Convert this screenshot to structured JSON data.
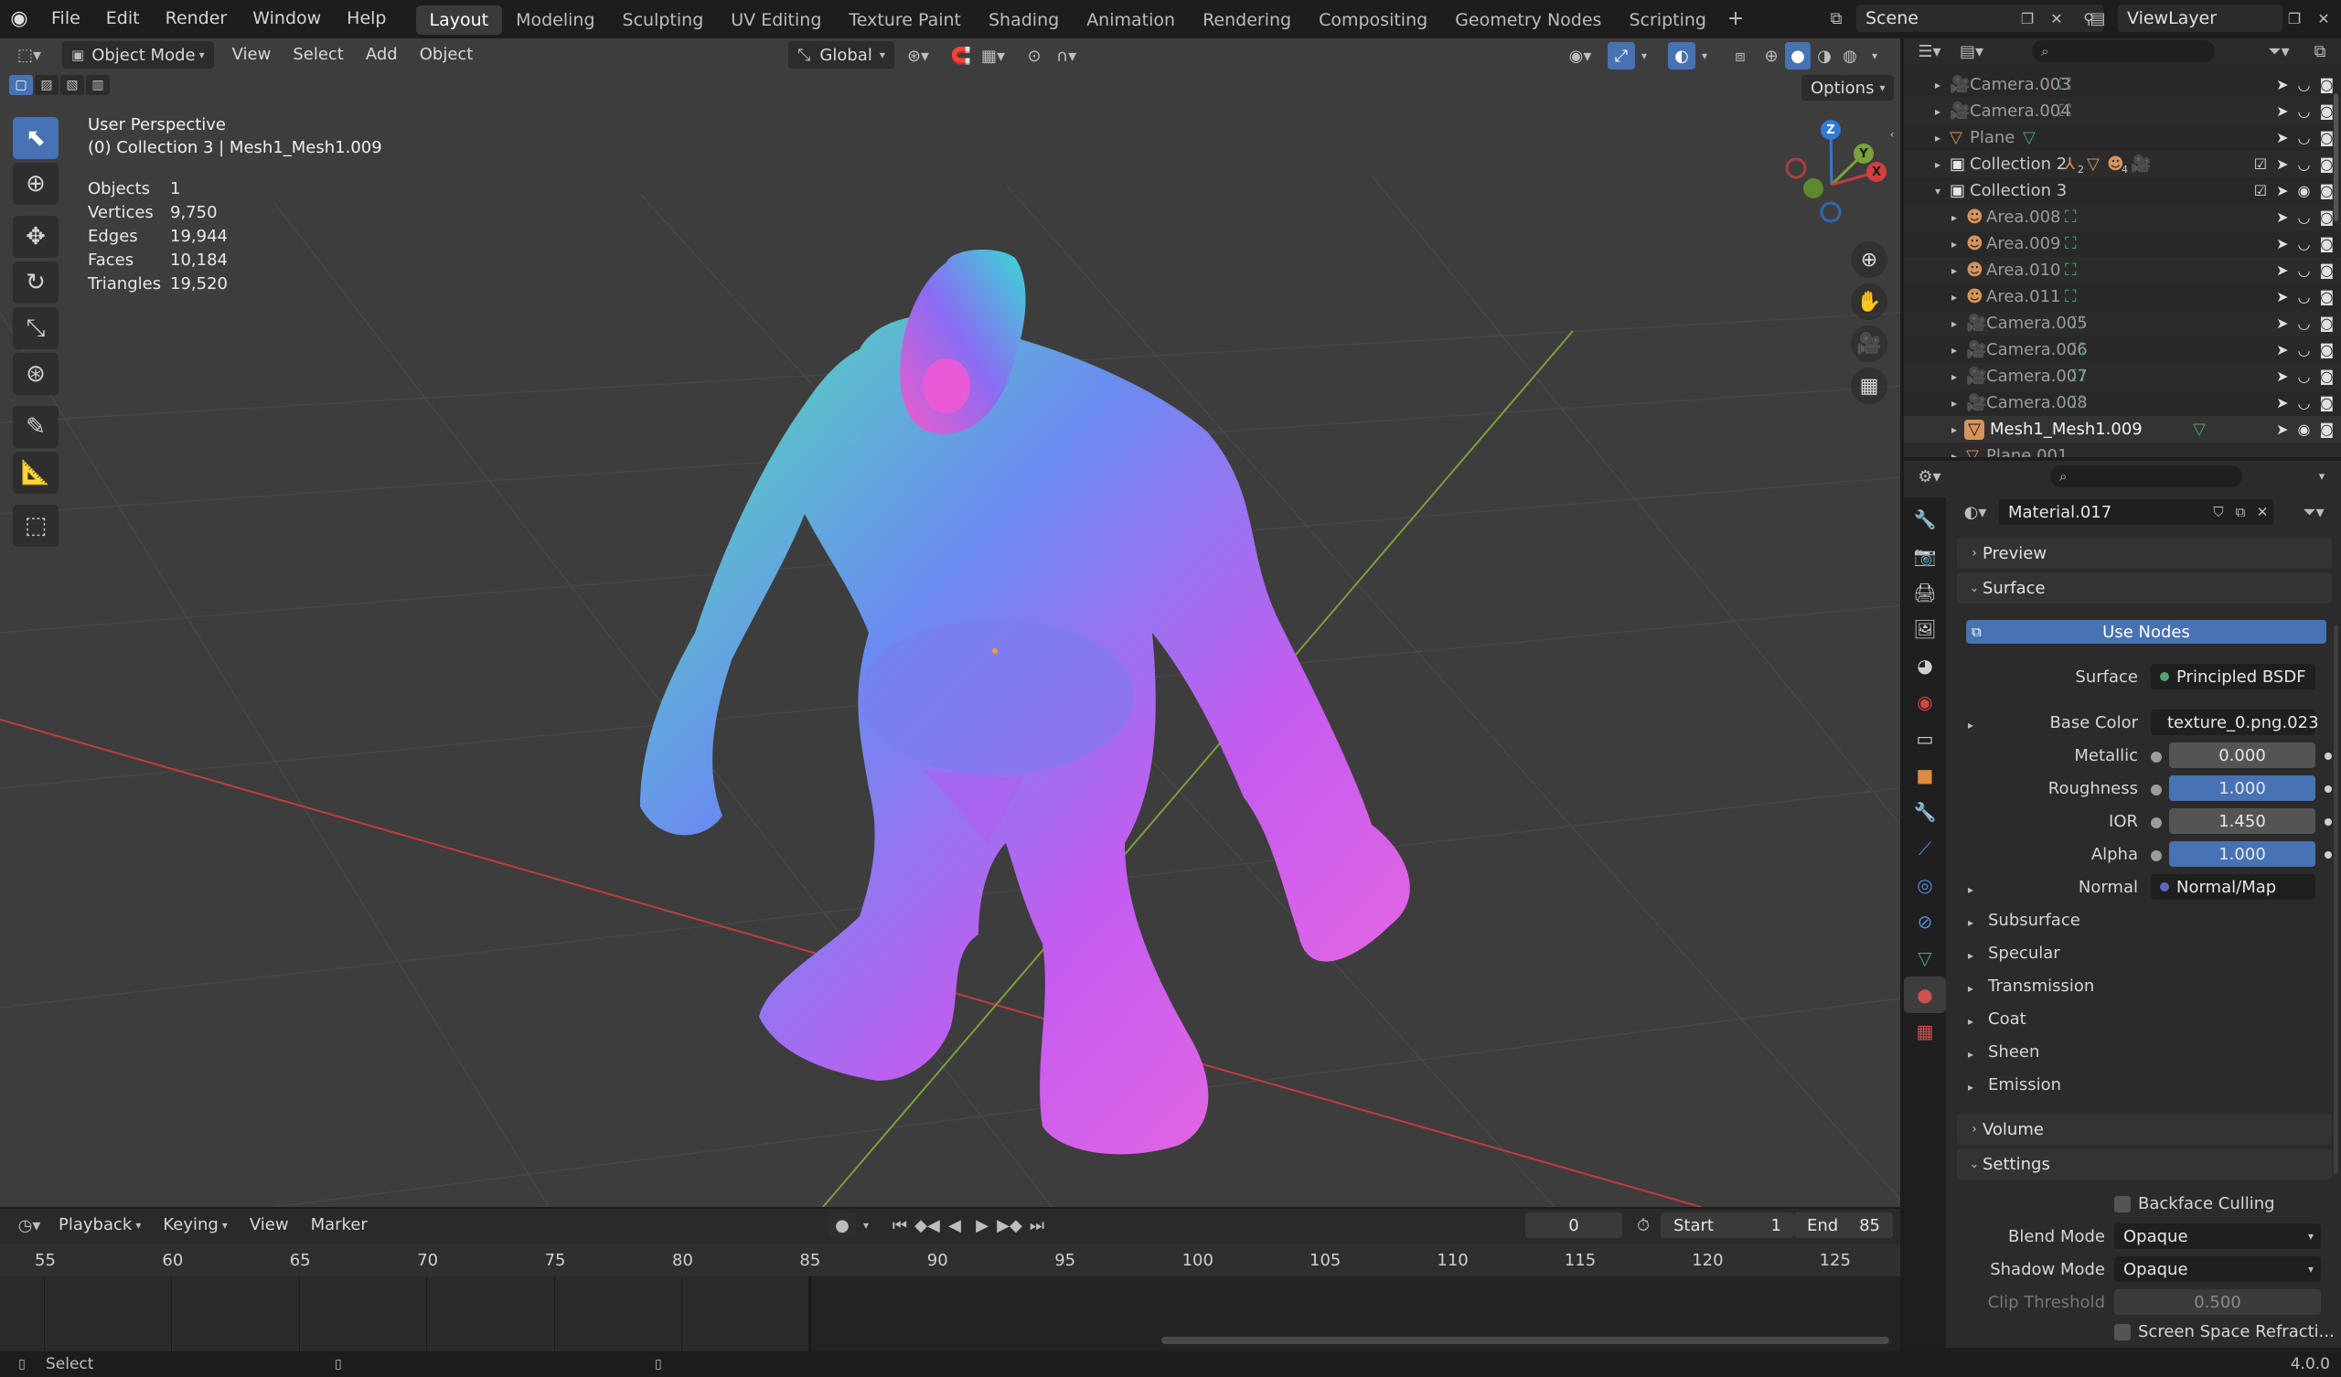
{
  "menus": [
    "File",
    "Edit",
    "Render",
    "Window",
    "Help"
  ],
  "workspaces": [
    "Layout",
    "Modeling",
    "Sculpting",
    "UV Editing",
    "Texture Paint",
    "Shading",
    "Animation",
    "Rendering",
    "Compositing",
    "Geometry Nodes",
    "Scripting"
  ],
  "scene": "Scene",
  "view_layer": "ViewLayer",
  "viewport": {
    "mode": "Object Mode",
    "menus": [
      "View",
      "Select",
      "Add",
      "Object"
    ],
    "orientation": "Global",
    "options": "Options",
    "perspective": "User Perspective",
    "collection_info": "(0) Collection 3 | Mesh1_Mesh1.009",
    "stats": [
      {
        "label": "Objects",
        "value": "1"
      },
      {
        "label": "Vertices",
        "value": "9,750"
      },
      {
        "label": "Edges",
        "value": "19,944"
      },
      {
        "label": "Faces",
        "value": "10,184"
      },
      {
        "label": "Triangles",
        "value": "19,520"
      }
    ],
    "gizmo": {
      "z": "Z",
      "y": "Y",
      "x": "X"
    }
  },
  "outliner": {
    "rows": [
      {
        "name": "Camera.003",
        "type": "camera"
      },
      {
        "name": "Camera.004",
        "type": "camera"
      },
      {
        "name": "Plane",
        "type": "mesh"
      },
      {
        "name": "Collection 2",
        "type": "collection"
      },
      {
        "name": "Collection 3",
        "type": "collection"
      },
      {
        "name": "Area.008",
        "type": "light"
      },
      {
        "name": "Area.009",
        "type": "light"
      },
      {
        "name": "Area.010",
        "type": "light"
      },
      {
        "name": "Area.011",
        "type": "light"
      },
      {
        "name": "Camera.005",
        "type": "camera"
      },
      {
        "name": "Camera.006",
        "type": "camera"
      },
      {
        "name": "Camera.007",
        "type": "camera"
      },
      {
        "name": "Camera.008",
        "type": "camera"
      },
      {
        "name": "Mesh1_Mesh1.009",
        "type": "mesh"
      },
      {
        "name": "Plane.001",
        "type": "mesh"
      }
    ],
    "collection2_badges": [
      "2",
      "4"
    ]
  },
  "properties": {
    "material_name": "Material.017",
    "preview": "Preview",
    "surface_panel": "Surface",
    "use_nodes": "Use Nodes",
    "surface_label": "Surface",
    "surface_value": "Principled BSDF",
    "base_color_label": "Base Color",
    "base_color_value": "texture_0.png.023",
    "metallic_label": "Metallic",
    "metallic_value": "0.000",
    "roughness_label": "Roughness",
    "roughness_value": "1.000",
    "ior_label": "IOR",
    "ior_value": "1.450",
    "alpha_label": "Alpha",
    "alpha_value": "1.000",
    "normal_label": "Normal",
    "normal_value": "Normal/Map",
    "subsections": [
      "Subsurface",
      "Specular",
      "Transmission",
      "Coat",
      "Sheen",
      "Emission"
    ],
    "volume": "Volume",
    "settings": "Settings",
    "backface_culling": "Backface Culling",
    "blend_mode_label": "Blend Mode",
    "blend_mode_value": "Opaque",
    "shadow_mode_label": "Shadow Mode",
    "shadow_mode_value": "Opaque",
    "clip_threshold_label": "Clip Threshold",
    "clip_threshold_value": "0.500",
    "screen_space": "Screen Space Refracti..."
  },
  "timeline": {
    "menus": [
      "Playback",
      "Keying",
      "View",
      "Marker"
    ],
    "current_frame": "0",
    "start_label": "Start",
    "start_value": "1",
    "end_label": "End",
    "end_value": "85",
    "ticks": [
      "55",
      "60",
      "65",
      "70",
      "75",
      "80",
      "85",
      "90",
      "95",
      "100",
      "105",
      "110",
      "115",
      "120",
      "125"
    ]
  },
  "status": {
    "select": "Select",
    "version": "4.0.0"
  },
  "colors": {
    "accent": "#4772b3",
    "viewport_bg": "#3d3d3d",
    "axis_x": "#c33c3c",
    "axis_y": "#7aa13c"
  }
}
